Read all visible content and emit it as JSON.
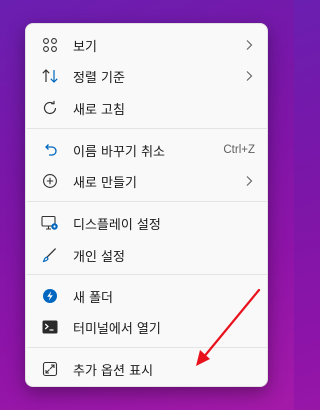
{
  "context_menu": {
    "items": [
      {
        "label": "보기",
        "icon": "grid-icon",
        "has_submenu": true
      },
      {
        "label": "정렬 기준",
        "icon": "sort-icon",
        "has_submenu": true
      },
      {
        "label": "새로 고침",
        "icon": "refresh-icon",
        "has_submenu": false
      },
      {
        "label": "이름 바꾸기 취소",
        "icon": "undo-icon",
        "shortcut": "Ctrl+Z"
      },
      {
        "label": "새로 만들기",
        "icon": "plus-circle-icon",
        "has_submenu": true
      },
      {
        "label": "디스플레이 설정",
        "icon": "display-settings-icon"
      },
      {
        "label": "개인 설정",
        "icon": "brush-icon"
      },
      {
        "label": "새 폴더",
        "icon": "new-folder-icon"
      },
      {
        "label": "터미널에서 열기",
        "icon": "terminal-icon"
      },
      {
        "label": "추가 옵션 표시",
        "icon": "show-more-icon"
      }
    ]
  },
  "colors": {
    "accent": "#0067c0",
    "annotation_arrow": "#e8121d"
  }
}
